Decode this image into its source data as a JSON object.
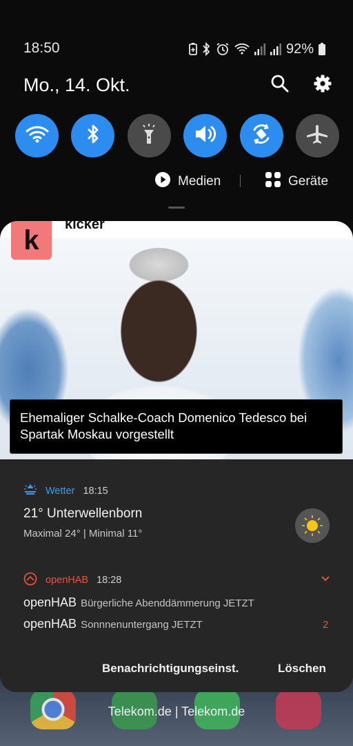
{
  "status": {
    "time": "18:50",
    "battery": "92%",
    "icons": [
      "battery-saver-icon",
      "bluetooth-icon",
      "alarm-icon",
      "wifi-icon",
      "signal-icon",
      "signal-icon",
      "battery-icon"
    ]
  },
  "header": {
    "date": "Mo., 14. Okt.",
    "actions": [
      "search-icon",
      "settings-icon"
    ]
  },
  "quick_toggles": [
    {
      "name": "wifi",
      "icon": "wifi-icon",
      "on": true
    },
    {
      "name": "bluetooth",
      "icon": "bluetooth-icon",
      "on": true
    },
    {
      "name": "flashlight",
      "icon": "flashlight-icon",
      "on": false
    },
    {
      "name": "sound",
      "icon": "volume-icon",
      "on": true
    },
    {
      "name": "auto-rotate",
      "icon": "rotate-icon",
      "on": true
    },
    {
      "name": "airplane",
      "icon": "airplane-icon",
      "on": false
    }
  ],
  "media_row": {
    "media_label": "Medien",
    "devices_label": "Geräte"
  },
  "kicker": {
    "app_name": "kicker",
    "logo_letter": "k",
    "headline": "Ehemaliger Schalke-Coach Domenico Tedesco bei Spartak Moskau vorgestellt"
  },
  "weather": {
    "app": "Wetter",
    "time": "18:15",
    "title": "21° Unterwellenborn",
    "subtitle": "Maximal 24° | Minimal 11°"
  },
  "openhab": {
    "app": "openHAB",
    "time": "18:28",
    "lines": [
      {
        "title": "openHAB",
        "text": "Bürgerliche Abenddämmerung JETZT"
      },
      {
        "title": "openHAB",
        "text": "Sonnnenuntergang JETZT"
      }
    ],
    "count": "2"
  },
  "footer": {
    "settings_label": "Benachrichtigungseinst.",
    "clear_label": "Löschen"
  },
  "home": {
    "carrier": "Telekom.de | Telekom.de"
  },
  "colors": {
    "accent_blue": "#2d8cf0",
    "openhab_orange": "#e7543a",
    "kicker_logo": "#f2797a"
  }
}
